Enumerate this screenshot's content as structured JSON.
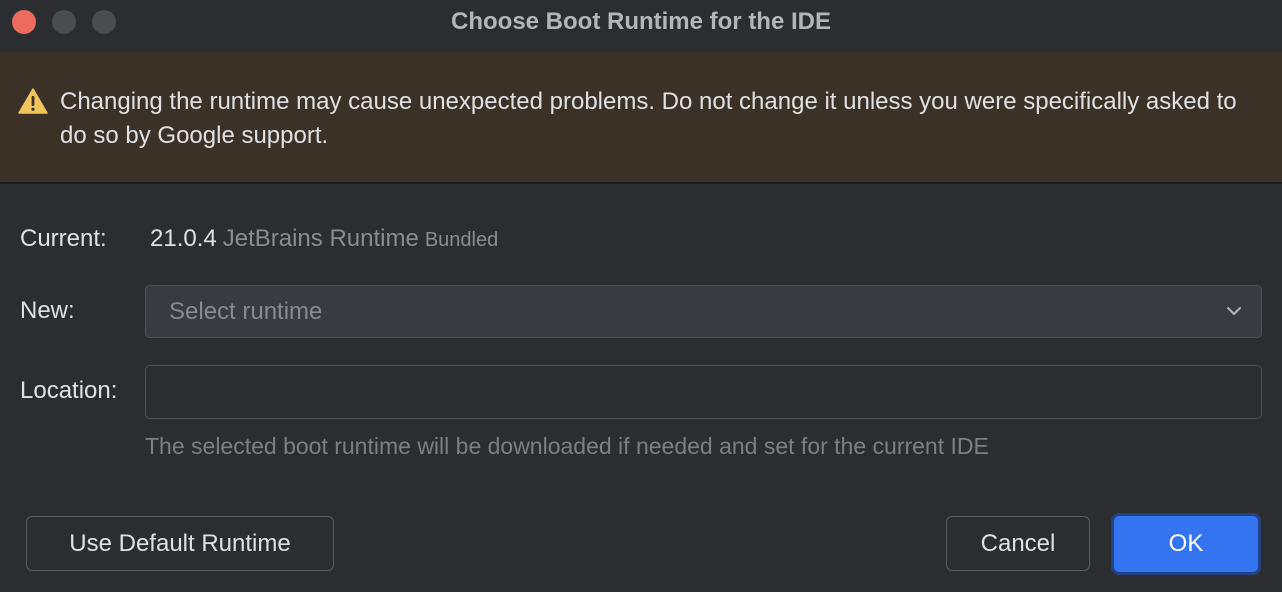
{
  "window": {
    "title": "Choose Boot Runtime for the IDE"
  },
  "warning": {
    "icon": "warning-icon",
    "text": "Changing the runtime may cause unexpected problems. Do not change it unless you were specifically asked to do so by Google support."
  },
  "current": {
    "label": "Current:",
    "version": "21.0.4",
    "vendor": "JetBrains Runtime",
    "tag": "Bundled"
  },
  "new": {
    "label": "New:",
    "placeholder": "Select runtime"
  },
  "location": {
    "label": "Location:",
    "value": ""
  },
  "hint": "The selected boot runtime will be downloaded if needed and set for the current IDE",
  "buttons": {
    "use_default": "Use Default Runtime",
    "cancel": "Cancel",
    "ok": "OK"
  },
  "colors": {
    "background": "#2b2d30",
    "warning_banner": "#3c3126",
    "warning_icon": "#f2c55c",
    "accent": "#3574f0",
    "close_button": "#ed6a5e"
  }
}
